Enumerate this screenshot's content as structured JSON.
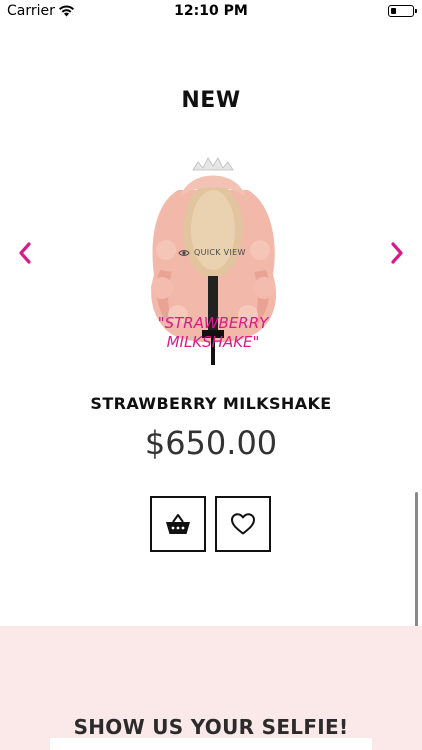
{
  "status_bar": {
    "carrier": "Carrier",
    "time": "12:10 PM",
    "wifi_icon": "wifi-icon",
    "battery_icon": "battery-icon",
    "battery_level": 0.25
  },
  "section": {
    "title": "NEW"
  },
  "carousel": {
    "prev_icon": "chevron-left-icon",
    "next_icon": "chevron-right-icon",
    "accent_color": "#d81b8a"
  },
  "product": {
    "image_text_line1": "\"STRAWBERRY",
    "image_text_line2": "MILKSHAKE\"",
    "quick_view_label": "QUICK VIEW",
    "name": "STRAWBERRY MILKSHAKE",
    "price": "$650.00"
  },
  "actions": {
    "cart_icon": "basket-icon",
    "wishlist_icon": "heart-icon"
  },
  "selfie": {
    "title": "SHOW US YOUR SELFIE!",
    "background_color": "#fbe9ea"
  }
}
